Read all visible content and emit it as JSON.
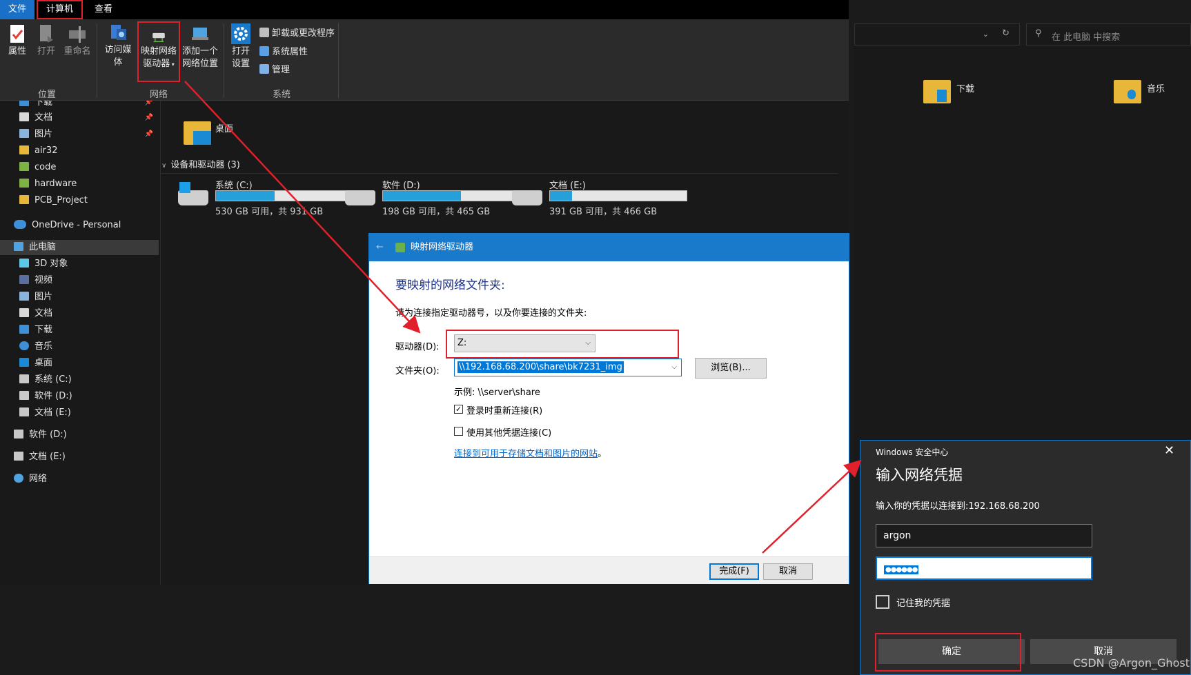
{
  "tabs": {
    "file": "文件",
    "computer": "计算机",
    "view": "查看"
  },
  "ribbon": {
    "properties": "属性",
    "open": "打开",
    "rename": "重命名",
    "access_media": "访问媒体",
    "map_drive_l1": "映射网络",
    "map_drive_l2": "驱动器",
    "add_location_l1": "添加一个",
    "add_location_l2": "网络位置",
    "open_settings_l1": "打开",
    "open_settings_l2": "设置",
    "uninstall": "卸载或更改程序",
    "sys_props": "系统属性",
    "manage": "管理",
    "group_location": "位置",
    "group_network": "网络",
    "group_system": "系统"
  },
  "sidebar": {
    "items": [
      {
        "label": "下载",
        "pinned": true
      },
      {
        "label": "文档",
        "pinned": true
      },
      {
        "label": "图片",
        "pinned": true
      },
      {
        "label": "air32"
      },
      {
        "label": "code"
      },
      {
        "label": "hardware"
      },
      {
        "label": "PCB_Project"
      },
      {
        "label": "OneDrive - Personal"
      },
      {
        "label": "此电脑"
      },
      {
        "label": "3D 对象"
      },
      {
        "label": "视频"
      },
      {
        "label": "图片"
      },
      {
        "label": "文档"
      },
      {
        "label": "下载"
      },
      {
        "label": "音乐"
      },
      {
        "label": "桌面"
      },
      {
        "label": "系统 (C:)"
      },
      {
        "label": "软件 (D:)"
      },
      {
        "label": "文档 (E:)"
      },
      {
        "label": "软件 (D:)"
      },
      {
        "label": "文档 (E:)"
      },
      {
        "label": "网络"
      }
    ]
  },
  "content": {
    "desktop_folder": "桌面",
    "devices_header": "设备和驱动器 (3)",
    "drives": [
      {
        "name": "系统 (C:)",
        "free": "530 GB 可用，共 931 GB",
        "used_fraction": 0.43
      },
      {
        "name": "软件 (D:)",
        "free": "198 GB 可用，共 465 GB",
        "used_fraction": 0.57
      },
      {
        "name": "文档 (E:)",
        "free": "391 GB 可用，共 466 GB",
        "used_fraction": 0.16
      }
    ]
  },
  "right_pane": {
    "search_placeholder": "在 此电脑 中搜索",
    "folder_downloads": "下载",
    "folder_music": "音乐"
  },
  "map_dialog": {
    "title": "映射网络驱动器",
    "heading": "要映射的网络文件夹:",
    "instruction": "请为连接指定驱动器号，以及你要连接的文件夹:",
    "drive_label": "驱动器(D):",
    "drive_value": "Z:",
    "folder_label": "文件夹(O):",
    "folder_value": "\\\\192.168.68.200\\share\\bk7231_img",
    "browse": "浏览(B)...",
    "example": "示例: \\\\server\\share",
    "reconnect": "登录时重新连接(R)",
    "reconnect_checked": true,
    "other_creds": "使用其他凭据连接(C)",
    "other_creds_checked": false,
    "link": "连接到可用于存储文档和图片的网站",
    "link_suffix": "。",
    "finish": "完成(F)",
    "cancel": "取消"
  },
  "cred_dialog": {
    "app": "Windows 安全中心",
    "title": "输入网络凭据",
    "prompt": "输入你的凭据以连接到:192.168.68.200",
    "username": "argon",
    "password_mask": "●●●●●●",
    "remember": "记住我的凭据",
    "remember_checked": false,
    "ok": "确定",
    "cancel": "取消"
  },
  "watermark": "CSDN @Argon_Ghost",
  "colors": {
    "accent": "#1979ca",
    "annotation_red": "#e0202a",
    "bar_fill": "#26a0da"
  }
}
